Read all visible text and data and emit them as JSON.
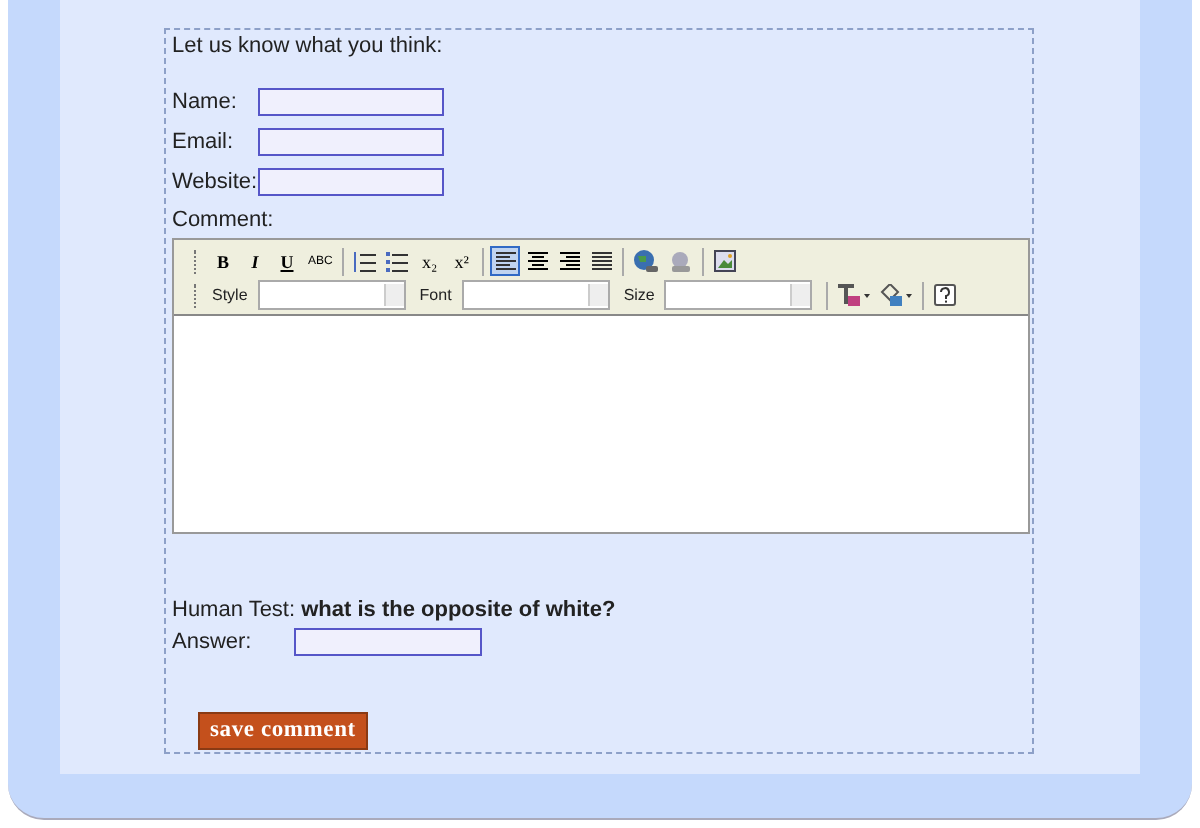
{
  "intro": "Let us know what you think:",
  "fields": [
    {
      "label": "Name:"
    },
    {
      "label": "Email:"
    },
    {
      "label": "Website:"
    }
  ],
  "comment": {
    "label": "Comment:",
    "toolbar": [
      {
        "kind": "bold",
        "label": "B",
        "selected": false
      },
      {
        "kind": "italic",
        "label": "I",
        "selected": false
      },
      {
        "kind": "underline",
        "label": "U",
        "selected": false
      },
      {
        "kind": "strike",
        "label": "ABC",
        "selected": false
      },
      {
        "kind": "sep"
      },
      {
        "kind": "ol",
        "selected": false
      },
      {
        "kind": "ul",
        "selected": false
      },
      {
        "kind": "sub",
        "label": "x₂",
        "selected": false
      },
      {
        "kind": "sup",
        "label": "x²",
        "selected": false
      },
      {
        "kind": "sep"
      },
      {
        "kind": "align-left",
        "selected": true
      },
      {
        "kind": "align-center",
        "selected": false
      },
      {
        "kind": "align-right",
        "selected": false
      },
      {
        "kind": "justify",
        "selected": false
      },
      {
        "kind": "sep"
      },
      {
        "kind": "link",
        "selected": false
      },
      {
        "kind": "unlink",
        "selected": false
      },
      {
        "kind": "sep"
      },
      {
        "kind": "image",
        "selected": false
      }
    ],
    "selects": [
      {
        "label": "Style"
      },
      {
        "label": "Font"
      },
      {
        "label": "Size"
      }
    ]
  },
  "human_test": "Human Test: **what is the opposite of white?**",
  "answer": {
    "label": "Answer:"
  },
  "submit": "save comment"
}
